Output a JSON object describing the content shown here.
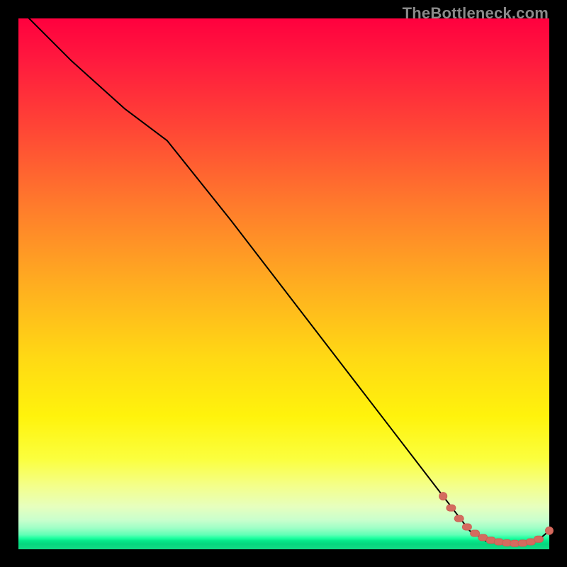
{
  "watermark_text": "TheBottleneck.com",
  "colors": {
    "background": "#000000",
    "curve": "#000000",
    "marker_fill": "#d46b5f",
    "marker_stroke": "#cc5f53"
  },
  "chart_data": {
    "type": "line",
    "title": "",
    "xlabel": "",
    "ylabel": "",
    "xlim": [
      0,
      100
    ],
    "ylim": [
      0,
      100
    ],
    "grid": false,
    "legend": false,
    "series": [
      {
        "name": "curve",
        "x": [
          2,
          10,
          20,
          28,
          40,
          50,
          60,
          70,
          80,
          85,
          88,
          90,
          92,
          94,
          96,
          98,
          100
        ],
        "y": [
          100,
          92,
          83,
          77,
          62,
          49,
          36,
          23,
          10,
          3.5,
          1.6,
          1.2,
          1.0,
          1.0,
          1.2,
          1.8,
          3.5
        ]
      }
    ],
    "markers": {
      "name": "dashed-segment-points",
      "x": [
        80.0,
        81.5,
        83.0,
        84.5,
        86.0,
        87.5,
        89.0,
        90.5,
        92.0,
        93.5,
        95.0,
        96.5,
        98.0,
        100.0
      ],
      "y": [
        10.0,
        7.8,
        5.8,
        4.2,
        3.0,
        2.2,
        1.7,
        1.4,
        1.2,
        1.1,
        1.15,
        1.4,
        1.9,
        3.5
      ]
    }
  }
}
